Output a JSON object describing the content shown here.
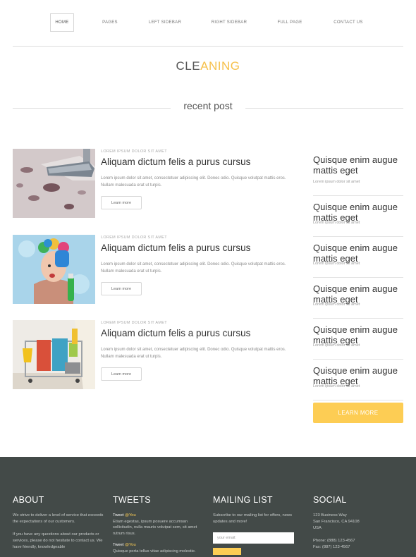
{
  "nav": {
    "items": [
      {
        "label": "HOME",
        "active": true
      },
      {
        "label": "PAGES",
        "active": false
      },
      {
        "label": "LEFT SIDEBAR",
        "active": false
      },
      {
        "label": "RIGHT SIDEBAR",
        "active": false
      },
      {
        "label": "FULL PAGE",
        "active": false
      },
      {
        "label": "CONTACT US",
        "active": false
      }
    ]
  },
  "logo": {
    "part1": "CLE",
    "part2": "ANING",
    "accent": "#f6c04a"
  },
  "section_title": "recent post",
  "posts": [
    {
      "meta": "LOREM IPSUM DOLOR SIT AMET",
      "title": "Aliquam dictum felis a purus cursus",
      "excerpt": "Lorem ipsum dolor sit amet, consectetuer adipiscing elit. Donec odio. Quisque volutpat mattis eros. Nullam malesuada erat ut turpis.",
      "button": "Learn more",
      "image": "vacuum-carpet-photo"
    },
    {
      "meta": "LOREM IPSUM DOLOR SIT AMET",
      "title": "Aliquam dictum felis a purus cursus",
      "excerpt": "Lorem ipsum dolor sit amet, consectetuer adipiscing elit. Donec odio. Quisque volutpat mattis eros. Nullam malesuada erat ut turpis.",
      "button": "Learn more",
      "image": "woman-cleaning-photo"
    },
    {
      "meta": "LOREM IPSUM DOLOR SIT AMET",
      "title": "Aliquam dictum felis a purus cursus",
      "excerpt": "Lorem ipsum dolor sit amet, consectetuer adipiscing elit. Donec odio. Quisque volutpat mattis eros. Nullam malesuada erat ut turpis.",
      "button": "Learn more",
      "image": "cleaning-cart-photo"
    }
  ],
  "sidebar": {
    "items": [
      {
        "title": "Quisque enim augue mattis eget",
        "sub": "Lorem ipsum dolor sit amet"
      },
      {
        "title": "Quisque enim augue mattis eget",
        "sub": "Lorem ipsum dolor sit amet"
      },
      {
        "title": "Quisque enim augue mattis eget",
        "sub": "Lorem ipsum dolor sit amet"
      },
      {
        "title": "Quisque enim augue mattis eget",
        "sub": "Lorem ipsum dolor sit amet"
      },
      {
        "title": "Quisque enim augue mattis eget",
        "sub": "Lorem ipsum dolor sit amet"
      },
      {
        "title": "Quisque enim augue mattis eget",
        "sub": "Lorem ipsum dolor sit amet"
      }
    ],
    "button": "LEARN MORE"
  },
  "footer": {
    "about": {
      "heading": "ABOUT",
      "p1": "We strive to deliver a level of service that exceeds the expectations of our customers.",
      "p2": "If you have any questions about our products or services, please do not hesitate to contact us. We have friendly, knowledgeable"
    },
    "tweets": {
      "heading": "TWEETS",
      "items": [
        {
          "who": "Tweet",
          "handle": "@You",
          "text": "Etiam egestas, ipsum posuere accumsan sollicitudin, nulla mauris volutpat sem, sit amet rutrum risus."
        },
        {
          "who": "Tweet",
          "handle": "@You",
          "text": "Quisque porta tellus vitae adipiscing molestie."
        }
      ]
    },
    "mailing": {
      "heading": "MAILING LIST",
      "text": "Subscribe to our mailing list for offers, news updates and more!",
      "placeholder": "your email:"
    },
    "social": {
      "heading": "SOCIAL",
      "address1": "123 Business Way",
      "address2": "San Francisco, CA 94108",
      "address3": "USA",
      "phone": "Phone: (888) 123-4567",
      "fax": "Fax: (887) 123-4567"
    }
  }
}
